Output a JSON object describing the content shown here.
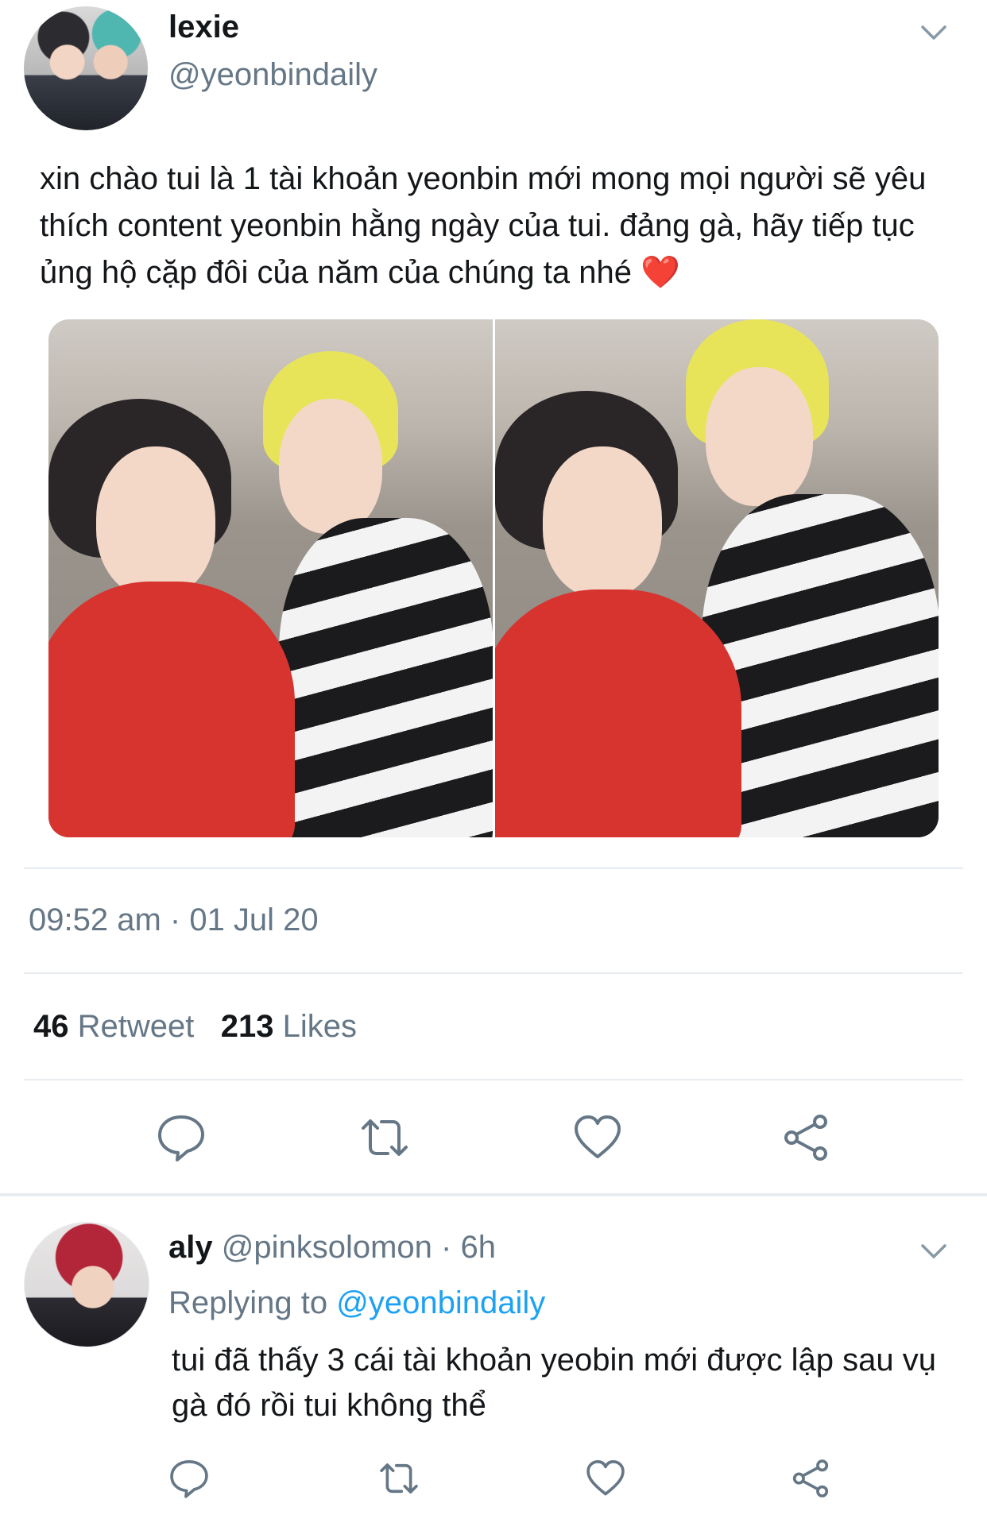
{
  "tweet": {
    "display_name": "lexie",
    "handle": "@yeonbindaily",
    "text": "xin chào tui là 1 tài khoản yeonbin mới mong mọi người sẽ yêu thích content yeonbin hằng ngày của tui. đảng gà, hãy tiếp tục ủng hộ cặp đôi của năm của chúng ta nhé ❤️",
    "timestamp": "09:52 am · 01 Jul 20",
    "retweet_count": "46",
    "retweet_label": "Retweet",
    "like_count": "213",
    "like_label": "Likes",
    "actions": [
      "reply-icon",
      "retweet-icon",
      "like-icon",
      "share-icon"
    ],
    "media_count": 2
  },
  "reply": {
    "display_name": "aly",
    "handle": "@pinksolomon",
    "time": "· 6h",
    "replying_prefix": "Replying to",
    "replying_handle": "@yeonbindaily",
    "text": "tui đã thấy 3 cái tài khoản yeobin mới được lập sau vụ gà đó rồi tui không thể",
    "actions": [
      "reply-icon",
      "retweet-icon",
      "like-icon",
      "share-icon"
    ]
  },
  "colors": {
    "text": "#14171a",
    "secondary": "#657786",
    "link": "#1da1f2",
    "divider": "#e6ecf0",
    "icon": "#657786"
  }
}
